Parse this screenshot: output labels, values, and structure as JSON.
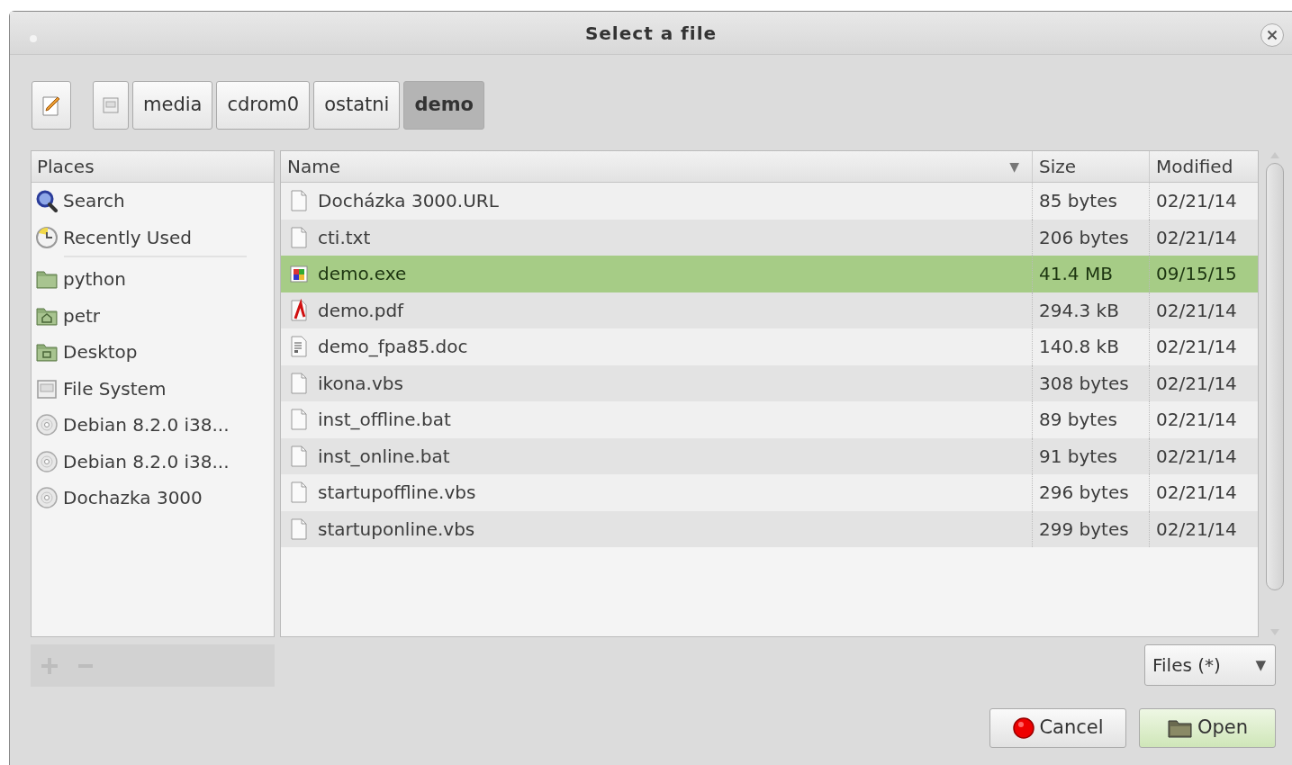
{
  "window": {
    "title": "Select a file"
  },
  "path_bar": [
    {
      "kind": "edit"
    },
    {
      "kind": "drive"
    },
    {
      "label": "media",
      "selected": false
    },
    {
      "label": "cdrom0",
      "selected": false
    },
    {
      "label": "ostatni",
      "selected": false
    },
    {
      "label": "demo",
      "selected": true
    }
  ],
  "places": {
    "header": "Places",
    "items": [
      {
        "label": "Search",
        "kind": "search",
        "separator_after": false
      },
      {
        "label": "Recently Used",
        "kind": "recent",
        "separator_after": true
      },
      {
        "label": "python",
        "kind": "folder",
        "separator_after": false
      },
      {
        "label": "petr",
        "kind": "home",
        "separator_after": false
      },
      {
        "label": "Desktop",
        "kind": "desktop",
        "separator_after": false
      },
      {
        "label": "File System",
        "kind": "drive",
        "separator_after": false
      },
      {
        "label": "Debian 8.2.0 i38...",
        "kind": "disc",
        "separator_after": false
      },
      {
        "label": "Debian 8.2.0 i38...",
        "kind": "disc",
        "separator_after": false
      },
      {
        "label": "Dochazka 3000",
        "kind": "disc",
        "separator_after": false
      }
    ]
  },
  "bookmark_buttons": [
    {
      "kind": "add",
      "disabled": true
    },
    {
      "kind": "remove",
      "disabled": true
    }
  ],
  "table": {
    "columns": [
      {
        "label": "Name",
        "sort_indicator": "▼"
      },
      {
        "label": "Size"
      },
      {
        "label": "Modified"
      }
    ],
    "rows": [
      {
        "name": "Docházka 3000.URL",
        "kind": "text",
        "size": "85 bytes",
        "modified": "02/21/14",
        "selected": false
      },
      {
        "name": "cti.txt",
        "kind": "text",
        "size": "206 bytes",
        "modified": "02/21/14",
        "selected": false
      },
      {
        "name": "demo.exe",
        "kind": "exe",
        "size": "41.4 MB",
        "modified": "09/15/15",
        "selected": true
      },
      {
        "name": "demo.pdf",
        "kind": "pdf",
        "size": "294.3 kB",
        "modified": "02/21/14",
        "selected": false
      },
      {
        "name": "demo_fpa85.doc",
        "kind": "doc",
        "size": "140.8 kB",
        "modified": "02/21/14",
        "selected": false
      },
      {
        "name": "ikona.vbs",
        "kind": "text",
        "size": "308 bytes",
        "modified": "02/21/14",
        "selected": false
      },
      {
        "name": "inst_offline.bat",
        "kind": "text",
        "size": "89 bytes",
        "modified": "02/21/14",
        "selected": false
      },
      {
        "name": "inst_online.bat",
        "kind": "text",
        "size": "91 bytes",
        "modified": "02/21/14",
        "selected": false
      },
      {
        "name": "startupoffline.vbs",
        "kind": "text",
        "size": "296 bytes",
        "modified": "02/21/14",
        "selected": false
      },
      {
        "name": "startuponline.vbs",
        "kind": "text",
        "size": "299 bytes",
        "modified": "02/21/14",
        "selected": false
      }
    ]
  },
  "filter": {
    "value": "Files (*)",
    "arrow": "▼"
  },
  "buttons": [
    {
      "label": "Cancel",
      "kind": "cancel"
    },
    {
      "label": "Open",
      "kind": "open"
    }
  ]
}
